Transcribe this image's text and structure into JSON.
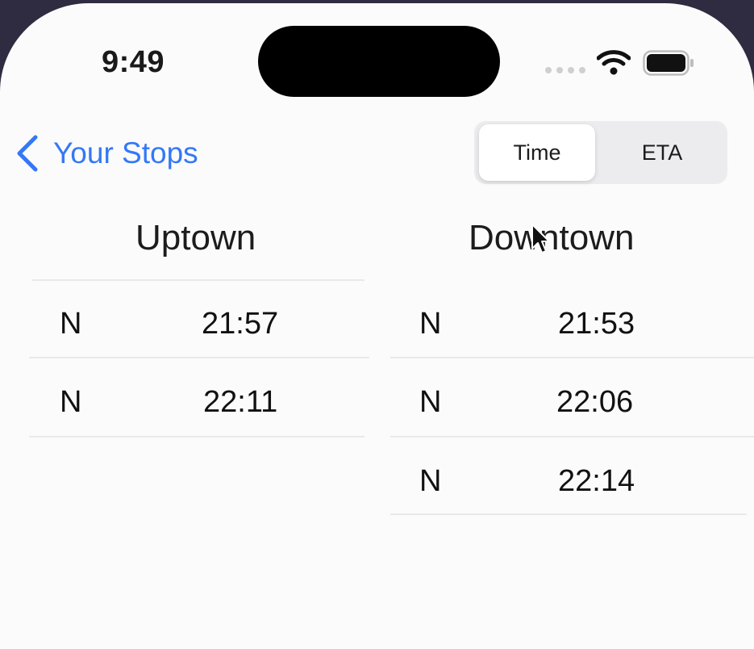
{
  "status_bar": {
    "time": "9:49",
    "icons": [
      "cellular-signal-icon",
      "wifi-icon",
      "battery-icon"
    ]
  },
  "nav": {
    "back_label": "Your Stops",
    "back_icon": "chevron-left-icon",
    "segments": [
      {
        "label": "Time",
        "selected": true
      },
      {
        "label": "ETA",
        "selected": false
      }
    ]
  },
  "uptown": {
    "title": "Uptown",
    "rows": [
      {
        "line": "N",
        "time": "21:57"
      },
      {
        "line": "N",
        "time": "22:11"
      }
    ]
  },
  "downtown": {
    "title": "Downtown",
    "rows": [
      {
        "line": "N",
        "time": "21:53"
      },
      {
        "line": "N",
        "time": "22:06"
      },
      {
        "line": "N",
        "time": "22:14"
      }
    ]
  },
  "colors": {
    "accent": "#3478f6",
    "background": "#fbfbfb",
    "segment_bg": "#ececef"
  }
}
